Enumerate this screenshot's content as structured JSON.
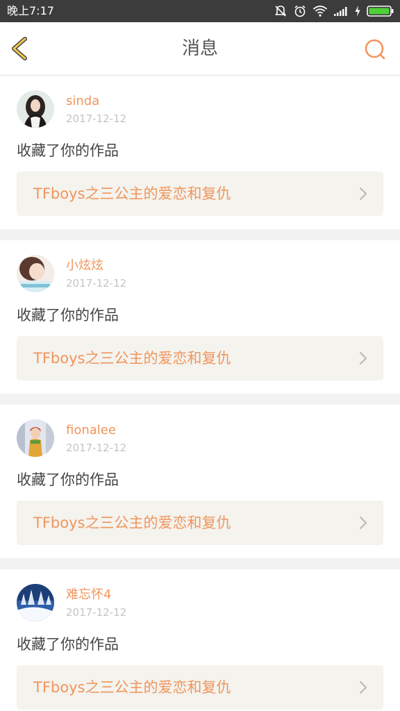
{
  "status_bar": {
    "time": "晚上7:17",
    "icons": [
      "mute-icon",
      "alarm-icon",
      "wifi-icon",
      "signal-icon",
      "charging-icon",
      "battery-icon"
    ]
  },
  "header": {
    "title": "消息",
    "back_icon": "chevron-left-icon",
    "search_icon": "search-icon"
  },
  "colors": {
    "accent": "#f0955c",
    "back_icon": "#f0c94a",
    "card_background": "#f4f3ee",
    "page_background": "#f2f2f2"
  },
  "messages": [
    {
      "username": "sinda",
      "date": "2017-12-12",
      "action": "收藏了你的作品",
      "work_title": "TFboys之三公主的爱恋和复仇"
    },
    {
      "username": "小炫炫",
      "date": "2017-12-12",
      "action": "收藏了你的作品",
      "work_title": "TFboys之三公主的爱恋和复仇"
    },
    {
      "username": "fionalee",
      "date": "2017-12-12",
      "action": "收藏了你的作品",
      "work_title": "TFboys之三公主的爱恋和复仇"
    },
    {
      "username": "难忘怀4",
      "date": "2017-12-12",
      "action": "收藏了你的作品",
      "work_title": "TFboys之三公主的爱恋和复仇"
    }
  ]
}
